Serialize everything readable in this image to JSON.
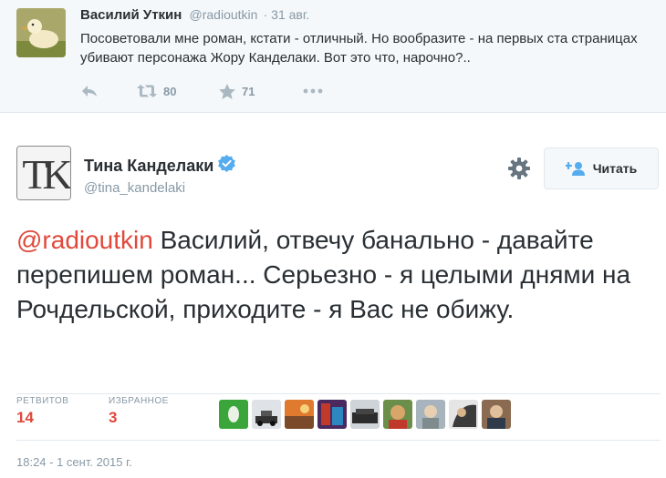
{
  "reply_tweet": {
    "name": "Василий Уткин",
    "handle": "@radioutkin",
    "date": "· 31 авг.",
    "text": "Посоветовали мне роман, кстати - отличный. Но вообразите - на первых ста страницах убивают персонажа Жору Канделаки. Вот это что, нарочно?..",
    "actions": {
      "reply_icon": "reply-icon",
      "retweet_icon": "retweet-icon",
      "retweets": "80",
      "favorite_icon": "star-icon",
      "favorites": "71",
      "more_icon": "more-dots-icon"
    }
  },
  "main_tweet": {
    "name": "Тина Канделаки",
    "verified_icon": "verified-badge-icon",
    "handle": "@tina_kandelaki",
    "avatar_logo_text": "TK",
    "follow_button": "Читать",
    "mention": "@radioutkin",
    "text": " Василий, отвечу банально - давайте перепишем роман... Серьезно - я целыми днями на Рочдельской, приходите - я Вас не обижу.",
    "stats": {
      "retweets_label": "РЕТВИТОВ",
      "retweets": "14",
      "favorites_label": "ИЗБРАННОЕ",
      "favorites": "3"
    },
    "favoriter_avatars": [
      "avatar-1",
      "avatar-2",
      "avatar-3",
      "avatar-4",
      "avatar-5",
      "avatar-6",
      "avatar-7",
      "avatar-8",
      "avatar-9"
    ],
    "timestamp": "18:24 - 1 сент. 2015 г."
  },
  "colors": {
    "mention": "#e0493b",
    "muted": "#8899a6",
    "text": "#292f33",
    "verified": "#55acee"
  }
}
